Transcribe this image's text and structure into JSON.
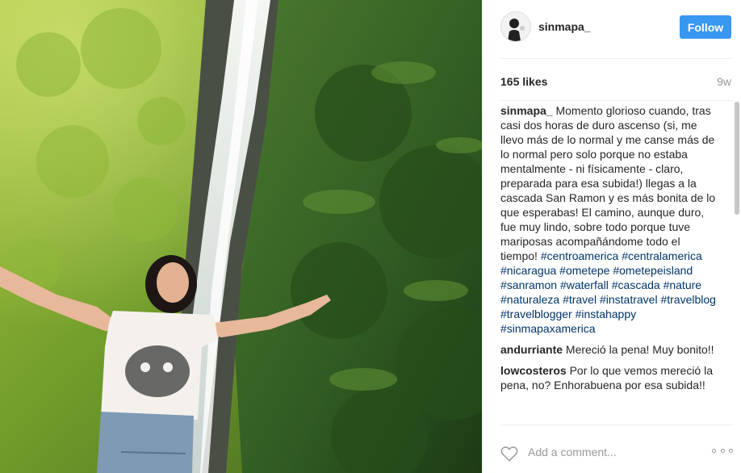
{
  "post": {
    "username": "sinmapa_",
    "follow_label": "Follow",
    "likes": "165 likes",
    "age": "9w",
    "add_comment_placeholder": "Add a comment..."
  },
  "caption": {
    "user": "sinmapa_",
    "text": "Momento glorioso cuando, tras casi dos horas de duro ascenso (si, me llevo más de lo normal y me canse más de lo normal pero solo porque no estaba mentalmente - ni físicamente - claro, preparada para esa subida!) llegas a la cascada San Ramon y es más bonita de lo que esperabas! El camino, aunque duro, fue muy lindo, sobre todo porque tuve mariposas acompañándome todo el tiempo!",
    "hashtags": [
      "#centroamerica",
      "#centralamerica",
      "#nicaragua",
      "#ometepe",
      "#ometepeisland",
      "#sanramon",
      "#waterfall",
      "#cascada",
      "#nature",
      "#naturaleza",
      "#travel",
      "#instatravel",
      "#travelblog",
      "#travelblogger",
      "#instahappy",
      "#sinmapaxamerica"
    ]
  },
  "comments": [
    {
      "user": "andurriante",
      "text": "Mereció la pena! Muy bonito!!"
    },
    {
      "user": "lowcosteros",
      "text": "Por lo que vemos mereció la pena, no? Enhorabuena por esa subida!!"
    }
  ],
  "colors": {
    "accent": "#3897f0",
    "hashtag": "#003569",
    "muted": "#999999"
  },
  "icons": {
    "like": "heart-outline-icon",
    "more": "more-options-icon"
  }
}
